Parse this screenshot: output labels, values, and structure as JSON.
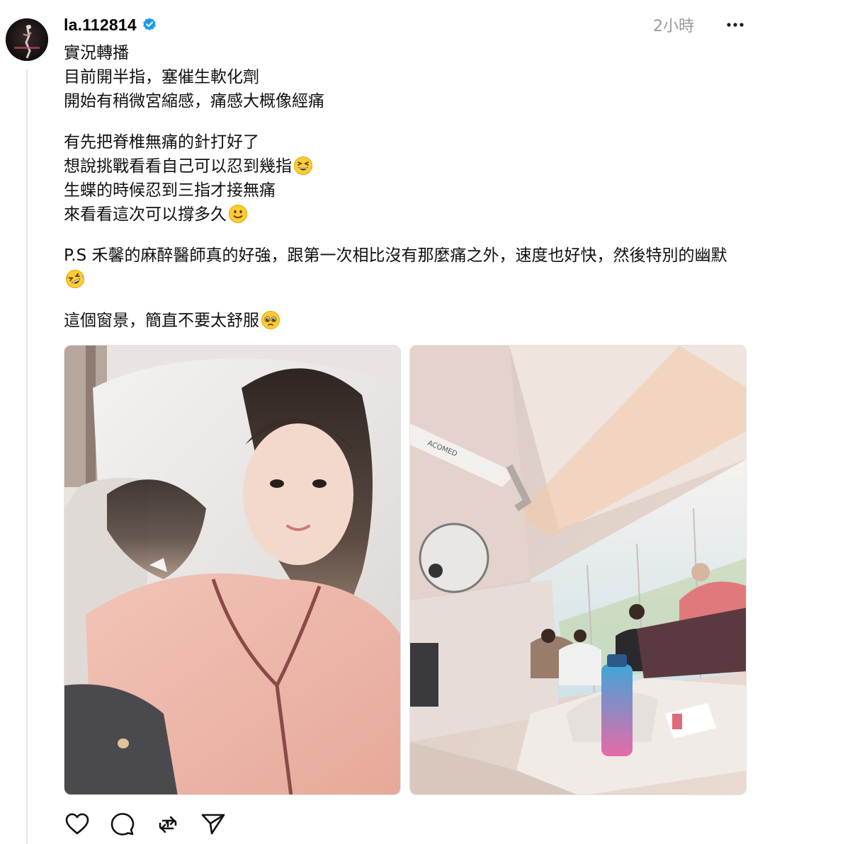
{
  "post": {
    "username": "la.112814",
    "verified": true,
    "timestamp": "2小時",
    "paragraphs": [
      {
        "lines": [
          "實況轉播",
          "目前開半指，塞催生軟化劑",
          "開始有稍微宮縮感，痛感大概像經痛"
        ]
      },
      {
        "lines": [
          "有先把脊椎無痛的針打好了",
          "想說挑戰看看自己可以忍到幾指",
          "生蝶的時候忍到三指才接無痛",
          "來看看這次可以撐多久"
        ]
      },
      {
        "lines": [
          "P.S 禾馨的麻醉醫師真的好強，跟第一次相比沒有那麼痛之外，速度也好快，然後特別的幽默"
        ]
      },
      {
        "lines": [
          "這個窗景，簡直不要太舒服"
        ]
      }
    ],
    "emojis": {
      "grinning_squint": "grinning-squinting-face-icon",
      "slight_smile": "slightly-smiling-face-icon",
      "rofl": "rolling-on-floor-laughing-icon",
      "pleading": "pleading-face-icon"
    },
    "photos": [
      {
        "alt": "selfie-in-hospital-bed"
      },
      {
        "alt": "delivery-room-window-view"
      }
    ]
  },
  "actions": [
    "like-icon",
    "comment-icon",
    "repost-icon",
    "share-icon"
  ],
  "colors": {
    "verified": "#1d9bf0",
    "muted": "#999999",
    "text": "#101010"
  }
}
